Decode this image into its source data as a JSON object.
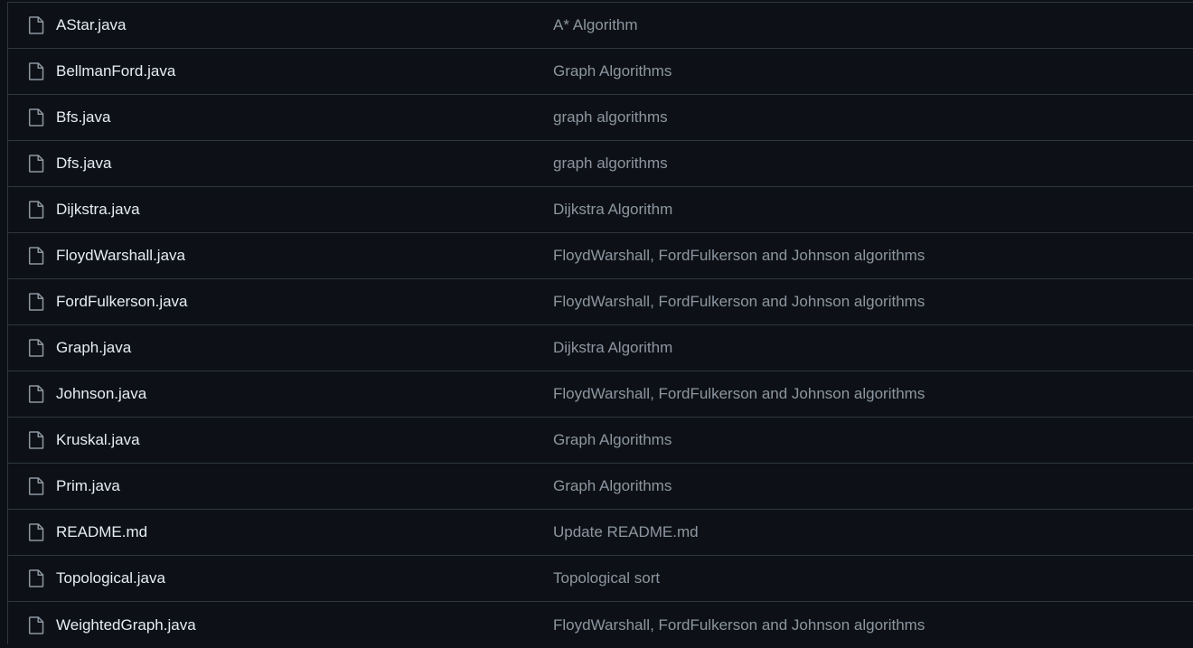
{
  "files": [
    {
      "icon": "file-icon",
      "name": "AStar.java",
      "commit_message": "A* Algorithm"
    },
    {
      "icon": "file-icon",
      "name": "BellmanFord.java",
      "commit_message": "Graph Algorithms"
    },
    {
      "icon": "file-icon",
      "name": "Bfs.java",
      "commit_message": "graph algorithms"
    },
    {
      "icon": "file-icon",
      "name": "Dfs.java",
      "commit_message": "graph algorithms"
    },
    {
      "icon": "file-icon",
      "name": "Dijkstra.java",
      "commit_message": "Dijkstra Algorithm"
    },
    {
      "icon": "file-icon",
      "name": "FloydWarshall.java",
      "commit_message": "FloydWarshall, FordFulkerson and Johnson algorithms"
    },
    {
      "icon": "file-icon",
      "name": "FordFulkerson.java",
      "commit_message": "FloydWarshall, FordFulkerson and Johnson algorithms"
    },
    {
      "icon": "file-icon",
      "name": "Graph.java",
      "commit_message": "Dijkstra Algorithm"
    },
    {
      "icon": "file-icon",
      "name": "Johnson.java",
      "commit_message": "FloydWarshall, FordFulkerson and Johnson algorithms"
    },
    {
      "icon": "file-icon",
      "name": "Kruskal.java",
      "commit_message": "Graph Algorithms"
    },
    {
      "icon": "file-icon",
      "name": "Prim.java",
      "commit_message": "Graph Algorithms"
    },
    {
      "icon": "file-icon",
      "name": "README.md",
      "commit_message": "Update README.md"
    },
    {
      "icon": "file-icon",
      "name": "Topological.java",
      "commit_message": "Topological sort"
    },
    {
      "icon": "file-icon",
      "name": "WeightedGraph.java",
      "commit_message": "FloydWarshall, FordFulkerson and Johnson algorithms"
    }
  ],
  "colors": {
    "background": "#0d1117",
    "border": "#30363d",
    "file_name": "#e6edf3",
    "commit_message": "#8d96a0",
    "icon": "#8d96a0"
  }
}
